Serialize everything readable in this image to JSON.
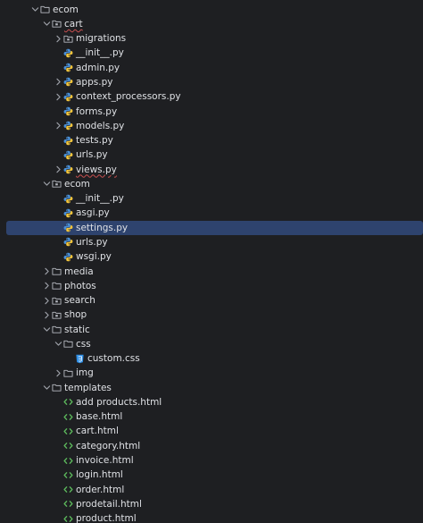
{
  "project_tree": {
    "nodes": [
      {
        "label": "ecom",
        "type": "folder",
        "depth": 0,
        "arrow": "open",
        "name": "tree-folder-ecom"
      },
      {
        "label": "cart",
        "type": "package",
        "depth": 1,
        "arrow": "open",
        "name": "tree-folder-cart",
        "error": true
      },
      {
        "label": "migrations",
        "type": "package",
        "depth": 2,
        "arrow": "closed",
        "name": "tree-folder-migrations"
      },
      {
        "label": "__init__.py",
        "type": "python",
        "depth": 2,
        "arrow": "none",
        "name": "tree-file-cart-init-py"
      },
      {
        "label": "admin.py",
        "type": "python",
        "depth": 2,
        "arrow": "none",
        "name": "tree-file-admin-py"
      },
      {
        "label": "apps.py",
        "type": "python",
        "depth": 2,
        "arrow": "closed",
        "name": "tree-file-apps-py"
      },
      {
        "label": "context_processors.py",
        "type": "python",
        "depth": 2,
        "arrow": "closed",
        "name": "tree-file-context-processors-py"
      },
      {
        "label": "forms.py",
        "type": "python",
        "depth": 2,
        "arrow": "none",
        "name": "tree-file-forms-py"
      },
      {
        "label": "models.py",
        "type": "python",
        "depth": 2,
        "arrow": "closed",
        "name": "tree-file-models-py"
      },
      {
        "label": "tests.py",
        "type": "python",
        "depth": 2,
        "arrow": "none",
        "name": "tree-file-tests-py"
      },
      {
        "label": "urls.py",
        "type": "python",
        "depth": 2,
        "arrow": "none",
        "name": "tree-file-cart-urls-py"
      },
      {
        "label": "views.py",
        "type": "python",
        "depth": 2,
        "arrow": "closed",
        "name": "tree-file-views-py",
        "error": true
      },
      {
        "label": "ecom",
        "type": "package",
        "depth": 1,
        "arrow": "open",
        "name": "tree-folder-ecom-inner"
      },
      {
        "label": "__init__.py",
        "type": "python",
        "depth": 2,
        "arrow": "none",
        "name": "tree-file-ecom-init-py"
      },
      {
        "label": "asgi.py",
        "type": "python",
        "depth": 2,
        "arrow": "none",
        "name": "tree-file-asgi-py"
      },
      {
        "label": "settings.py",
        "type": "python",
        "depth": 2,
        "arrow": "none",
        "name": "tree-file-settings-py",
        "selected": true
      },
      {
        "label": "urls.py",
        "type": "python",
        "depth": 2,
        "arrow": "none",
        "name": "tree-file-ecom-urls-py"
      },
      {
        "label": "wsgi.py",
        "type": "python",
        "depth": 2,
        "arrow": "none",
        "name": "tree-file-wsgi-py"
      },
      {
        "label": "media",
        "type": "folder",
        "depth": 1,
        "arrow": "closed",
        "name": "tree-folder-media"
      },
      {
        "label": "photos",
        "type": "folder",
        "depth": 1,
        "arrow": "closed",
        "name": "tree-folder-photos"
      },
      {
        "label": "search",
        "type": "package",
        "depth": 1,
        "arrow": "closed",
        "name": "tree-folder-search"
      },
      {
        "label": "shop",
        "type": "package",
        "depth": 1,
        "arrow": "closed",
        "name": "tree-folder-shop"
      },
      {
        "label": "static",
        "type": "folder",
        "depth": 1,
        "arrow": "open",
        "name": "tree-folder-static"
      },
      {
        "label": "css",
        "type": "folder",
        "depth": 2,
        "arrow": "open",
        "name": "tree-folder-css"
      },
      {
        "label": "custom.css",
        "type": "css",
        "depth": 3,
        "arrow": "none",
        "name": "tree-file-custom-css"
      },
      {
        "label": "img",
        "type": "folder",
        "depth": 2,
        "arrow": "closed",
        "name": "tree-folder-img"
      },
      {
        "label": "templates",
        "type": "folder",
        "depth": 1,
        "arrow": "open",
        "name": "tree-folder-templates"
      },
      {
        "label": "add products.html",
        "type": "html",
        "depth": 2,
        "arrow": "none",
        "name": "tree-file-add-products-html"
      },
      {
        "label": "base.html",
        "type": "html",
        "depth": 2,
        "arrow": "none",
        "name": "tree-file-base-html"
      },
      {
        "label": "cart.html",
        "type": "html",
        "depth": 2,
        "arrow": "none",
        "name": "tree-file-cart-html"
      },
      {
        "label": "category.html",
        "type": "html",
        "depth": 2,
        "arrow": "none",
        "name": "tree-file-category-html"
      },
      {
        "label": "invoice.html",
        "type": "html",
        "depth": 2,
        "arrow": "none",
        "name": "tree-file-invoice-html"
      },
      {
        "label": "login.html",
        "type": "html",
        "depth": 2,
        "arrow": "none",
        "name": "tree-file-login-html"
      },
      {
        "label": "order.html",
        "type": "html",
        "depth": 2,
        "arrow": "none",
        "name": "tree-file-order-html"
      },
      {
        "label": "prodetail.html",
        "type": "html",
        "depth": 2,
        "arrow": "none",
        "name": "tree-file-prodetail-html"
      },
      {
        "label": "product.html",
        "type": "html",
        "depth": 2,
        "arrow": "none",
        "name": "tree-file-product-html"
      }
    ]
  },
  "colors": {
    "background": "#1e1f22",
    "selection": "#2e436e",
    "text": "#dfe1e5",
    "error_underline": "#c94f4f"
  }
}
